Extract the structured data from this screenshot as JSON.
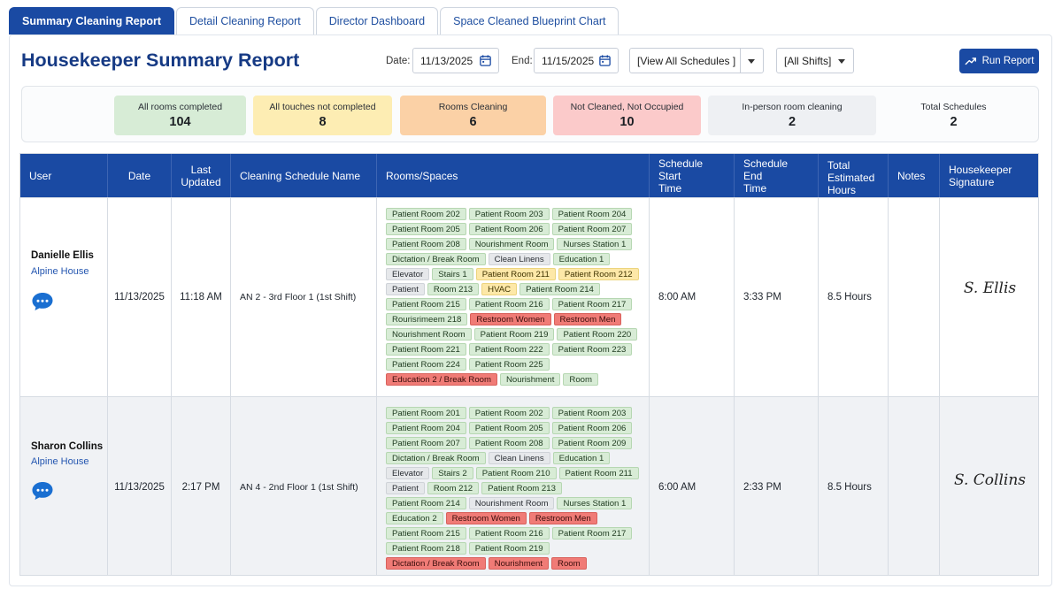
{
  "tabs": [
    {
      "label": "Summary Cleaning Report"
    },
    {
      "label": "Detail Cleaning Report"
    },
    {
      "label": "Director Dashboard"
    },
    {
      "label": "Space Cleaned Blueprint Chart"
    }
  ],
  "page_title": "Housekeeper Summary Report",
  "filters": {
    "date_label": "Date:",
    "date_value": "11/13/2025",
    "end_label": "End:",
    "end_value": "11/15/2025",
    "schedule_select": "[View All Schedules ]",
    "shift_select": "[All Shifts]",
    "run_label": "Run Report"
  },
  "stats": [
    {
      "label": "All rooms completed",
      "value": "104",
      "color": "#d7ecd6"
    },
    {
      "label": "All touches not completed",
      "value": "8",
      "color": "#fdedb3"
    },
    {
      "label": "Rooms Cleaning",
      "value": "6",
      "color": "#fbd1a6"
    },
    {
      "label": "Not Cleaned, Not Occupied",
      "value": "10",
      "color": "#fbcaca"
    },
    {
      "label": "In-person room cleaning",
      "value": "2",
      "color": "#eef0f3"
    },
    {
      "label": "Total Schedules",
      "value": "2",
      "color": "#fbfcfd"
    }
  ],
  "table": {
    "headers": {
      "user": "User",
      "date": "Date",
      "last_updated_1": "Last",
      "last_updated_2": "Updated",
      "schedule_name": "Cleaning Schedule Name",
      "rooms": "Rooms/Spaces",
      "start_1": "Schedule Start",
      "start_2": "Time",
      "end_1": "Schedule End",
      "end_2": "Time",
      "hours_1": "Total",
      "hours_2": "Estimated",
      "hours_3": "Hours",
      "notes": "Notes",
      "sig_1": "Housekeeper",
      "sig_2": "Signature"
    },
    "rows": [
      {
        "user": "Danielle Ellis",
        "location": "Alpine House",
        "date": "11/13/2025",
        "last_updated": "11:18 AM",
        "schedule_name": "AN 2 - 3rd Floor 1 (1st Shift)",
        "start": "8:00 AM",
        "end": "3:33 PM",
        "hours": "8.5 Hours",
        "notes": "",
        "signature": "S. Ellis",
        "rooms": [
          {
            "name": "Patient Room 202",
            "status": "g"
          },
          {
            "name": "Patient Room 203",
            "status": "g"
          },
          {
            "name": "Patient Room 204",
            "status": "g"
          },
          {
            "name": "Patient Room 205",
            "status": "g"
          },
          {
            "name": "Patient Room 206",
            "status": "g"
          },
          {
            "name": "Patient Room 207",
            "status": "g"
          },
          {
            "name": "Patient Room 208",
            "status": "g"
          },
          {
            "name": "Nourishment Room",
            "status": "g"
          },
          {
            "name": "Nurses Station 1",
            "status": "g"
          },
          {
            "name": "Dictation / Break Room",
            "status": "g"
          },
          {
            "name": "Clean Linens",
            "status": "gr"
          },
          {
            "name": "Education 1",
            "status": "g"
          },
          {
            "name": "Elevator",
            "status": "gr"
          },
          {
            "name": "Stairs 1",
            "status": "g"
          },
          {
            "name": "Patient Room 211",
            "status": "y"
          },
          {
            "name": "Patient Room 212",
            "status": "y"
          },
          {
            "name": "Patient",
            "status": "gr"
          },
          {
            "name": "Room 213",
            "status": "g"
          },
          {
            "name": "HVAC",
            "status": "y"
          },
          {
            "name": "Patient Room 214",
            "status": "g"
          },
          {
            "name": "Patient Room 215",
            "status": "g"
          },
          {
            "name": "Patient Room 216",
            "status": "g"
          },
          {
            "name": "Patient Room 217",
            "status": "g"
          },
          {
            "name": "Rourisrimeem 218",
            "status": "g"
          },
          {
            "name": "Restroom Women",
            "status": "r"
          },
          {
            "name": "Restroom Men",
            "status": "r"
          },
          {
            "name": "Nourishment Room",
            "status": "g"
          },
          {
            "name": "Patient Room 219",
            "status": "g"
          },
          {
            "name": "Patient Room 220",
            "status": "g"
          },
          {
            "name": "Patient Room 221",
            "status": "g"
          },
          {
            "name": "Patient Room 222",
            "status": "g"
          },
          {
            "name": "Patient Room 223",
            "status": "g"
          },
          {
            "name": "Patient Room 224",
            "status": "g"
          },
          {
            "name": "Patient Room 225",
            "status": "g"
          },
          {
            "name": "Education 2 / Break Room",
            "status": "r"
          },
          {
            "name": "Nourishment",
            "status": "g"
          },
          {
            "name": "Room",
            "status": "g"
          }
        ]
      },
      {
        "user": "Sharon Collins",
        "location": "Alpine House",
        "date": "11/13/2025",
        "last_updated": "2:17 PM",
        "schedule_name": "AN 4 - 2nd Floor 1 (1st Shift)",
        "start": "6:00 AM",
        "end": "2:33 PM",
        "hours": "8.5 Hours",
        "notes": "",
        "signature": "S. Collins",
        "rooms": [
          {
            "name": "Patient Room 201",
            "status": "g"
          },
          {
            "name": "Patient Room 202",
            "status": "g"
          },
          {
            "name": "Patient Room 203",
            "status": "g"
          },
          {
            "name": "Patient Room 204",
            "status": "g"
          },
          {
            "name": "Patient Room 205",
            "status": "g"
          },
          {
            "name": "Patient Room 206",
            "status": "g"
          },
          {
            "name": "Patient Room 207",
            "status": "g"
          },
          {
            "name": "Patient Room 208",
            "status": "g"
          },
          {
            "name": "Patient Room 209",
            "status": "g"
          },
          {
            "name": "Dictation / Break Room",
            "status": "g"
          },
          {
            "name": "Clean Linens",
            "status": "gr"
          },
          {
            "name": "Education 1",
            "status": "g"
          },
          {
            "name": "Elevator",
            "status": "gr"
          },
          {
            "name": "Stairs 2",
            "status": "g"
          },
          {
            "name": "Patient Room 210",
            "status": "g"
          },
          {
            "name": "Patient Room 211",
            "status": "g"
          },
          {
            "name": "Patient",
            "status": "gr"
          },
          {
            "name": "Room 212",
            "status": "g"
          },
          {
            "name": "Patient Room 213",
            "status": "g"
          },
          {
            "name": "Patient Room 214",
            "status": "g"
          },
          {
            "name": "Nourishment Room",
            "status": "gr"
          },
          {
            "name": "Nurses Station 1",
            "status": "g"
          },
          {
            "name": "Education 2",
            "status": "g"
          },
          {
            "name": "Restroom Women",
            "status": "r"
          },
          {
            "name": "Restroom Men",
            "status": "r"
          },
          {
            "name": "Patient Room 215",
            "status": "g"
          },
          {
            "name": "Patient Room 216",
            "status": "g"
          },
          {
            "name": "Patient Room 217",
            "status": "g"
          },
          {
            "name": "Patient Room 218",
            "status": "g"
          },
          {
            "name": "Patient Room 219",
            "status": "g"
          },
          {
            "name": "Dictation / Break Room",
            "status": "r"
          },
          {
            "name": "Nourishment",
            "status": "r"
          },
          {
            "name": "Room",
            "status": "r"
          }
        ]
      }
    ]
  }
}
